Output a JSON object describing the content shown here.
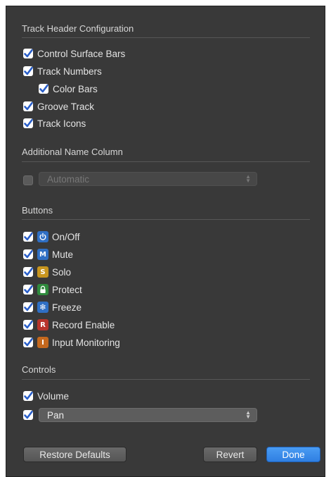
{
  "sections": {
    "track_header": "Track Header Configuration",
    "additional_name": "Additional Name Column",
    "buttons": "Buttons",
    "controls": "Controls"
  },
  "track_header": {
    "control_surface_bars": "Control Surface Bars",
    "track_numbers": "Track Numbers",
    "color_bars": "Color Bars",
    "groove_track": "Groove Track",
    "track_icons": "Track Icons"
  },
  "additional_name_column": {
    "checked": false,
    "select_value": "Automatic"
  },
  "buttons": {
    "on_off": {
      "label": "On/Off",
      "icon": "power-icon",
      "color": "#2f6fc4"
    },
    "mute": {
      "label": "Mute",
      "badge": "M",
      "color": "#2f6fc4"
    },
    "solo": {
      "label": "Solo",
      "badge": "S",
      "color": "#c8951e"
    },
    "protect": {
      "label": "Protect",
      "icon": "lock-icon",
      "color": "#2f8a3d"
    },
    "freeze": {
      "label": "Freeze",
      "icon": "snowflake-icon",
      "color": "#2f6fc4"
    },
    "record_enable": {
      "label": "Record Enable",
      "badge": "R",
      "color": "#b8352c"
    },
    "input_monitoring": {
      "label": "Input Monitoring",
      "badge": "I",
      "color": "#c4681e"
    }
  },
  "controls": {
    "volume": "Volume",
    "pan_value": "Pan"
  },
  "footer": {
    "restore_defaults": "Restore Defaults",
    "revert": "Revert",
    "done": "Done"
  },
  "colors": {
    "panel_bg": "#393939",
    "checkmark": "#2a5fc9",
    "done_button": "#3a8cf0"
  }
}
